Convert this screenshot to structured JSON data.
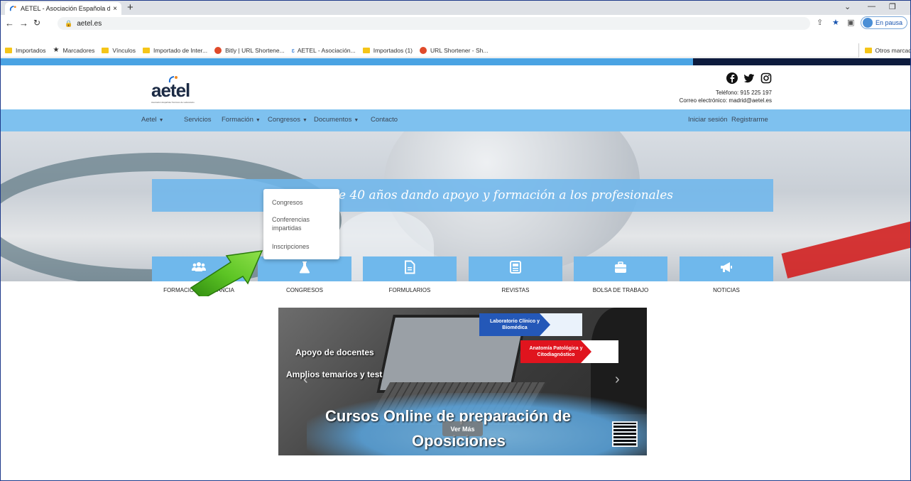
{
  "browser": {
    "tab_title": "AETEL - Asociación Española de ",
    "tab_close": "×",
    "new_tab": "+",
    "url": "aetel.es",
    "profile_label": "En pausa",
    "window_minimize": "—",
    "window_restore": "❐",
    "window_dropdown": "⌄",
    "bookmarks": [
      {
        "label": "Importados",
        "icon": "folder-icon"
      },
      {
        "label": "Marcadores",
        "icon": "star-icon"
      },
      {
        "label": "Vínculos",
        "icon": "folder-icon"
      },
      {
        "label": "Importado de Inter...",
        "icon": "folder-icon"
      },
      {
        "label": "Bitly | URL Shortene...",
        "icon": "bitly-icon"
      },
      {
        "label": "AETEL - Asociación...",
        "icon": "aetel-icon"
      },
      {
        "label": "Importados (1)",
        "icon": "folder-icon"
      },
      {
        "label": "URL Shortener - Sh...",
        "icon": "bitly-icon"
      }
    ],
    "other_bookmarks": "Otros marcad"
  },
  "site": {
    "logo_text": "aetel",
    "logo_subtitle": "Asociación Española Técnicos de Laboratorio",
    "phone": "Teléfono: 915 225 197",
    "email": "Correo electrónico: madrid@aetel.es",
    "nav": [
      {
        "label": "Aetel",
        "dropdown": true
      },
      {
        "label": "Servicios",
        "dropdown": false
      },
      {
        "label": "Formación",
        "dropdown": true
      },
      {
        "label": "Congresos",
        "dropdown": true
      },
      {
        "label": "Documentos",
        "dropdown": true
      },
      {
        "label": "Contacto",
        "dropdown": false
      }
    ],
    "login": "Iniciar sesión",
    "register": "Registrarme",
    "dropdown_items": [
      "Congresos",
      "Conferencias",
      "impartidas",
      "Inscripciones"
    ],
    "banner_text": "e 40 años dando apoyo y formación a los profesionales",
    "tiles": [
      {
        "label": "FORMACIÓN A DISTANCIA",
        "icon": "users-icon"
      },
      {
        "label": "CONGRESOS",
        "icon": "flask-icon"
      },
      {
        "label": "FORMULARIOS",
        "icon": "document-icon"
      },
      {
        "label": "REVISTAS",
        "icon": "newspaper-icon"
      },
      {
        "label": "BOLSA DE TRABAJO",
        "icon": "briefcase-icon"
      },
      {
        "label": "NOTICIAS",
        "icon": "megaphone-icon"
      }
    ],
    "carousel": {
      "line1": "Apoyo de docentes",
      "line2": "Amplios temarios y test",
      "tag1": "Laboratorio Clínico y Biomédica",
      "tag2": "Anatomía Patológica y Citodiagnóstico",
      "headline1": "Cursos Online de preparación de",
      "headline2": "Oposiciones",
      "button": "Ver Más"
    }
  },
  "colors": {
    "nav_bar": "#7ec1ef",
    "tile": "#6fb8ec",
    "top_strip": "#4aa3e3",
    "top_strip_dark": "#0d1b3d",
    "tag_blue": "#2458b8",
    "tag_red": "#e0141e"
  }
}
